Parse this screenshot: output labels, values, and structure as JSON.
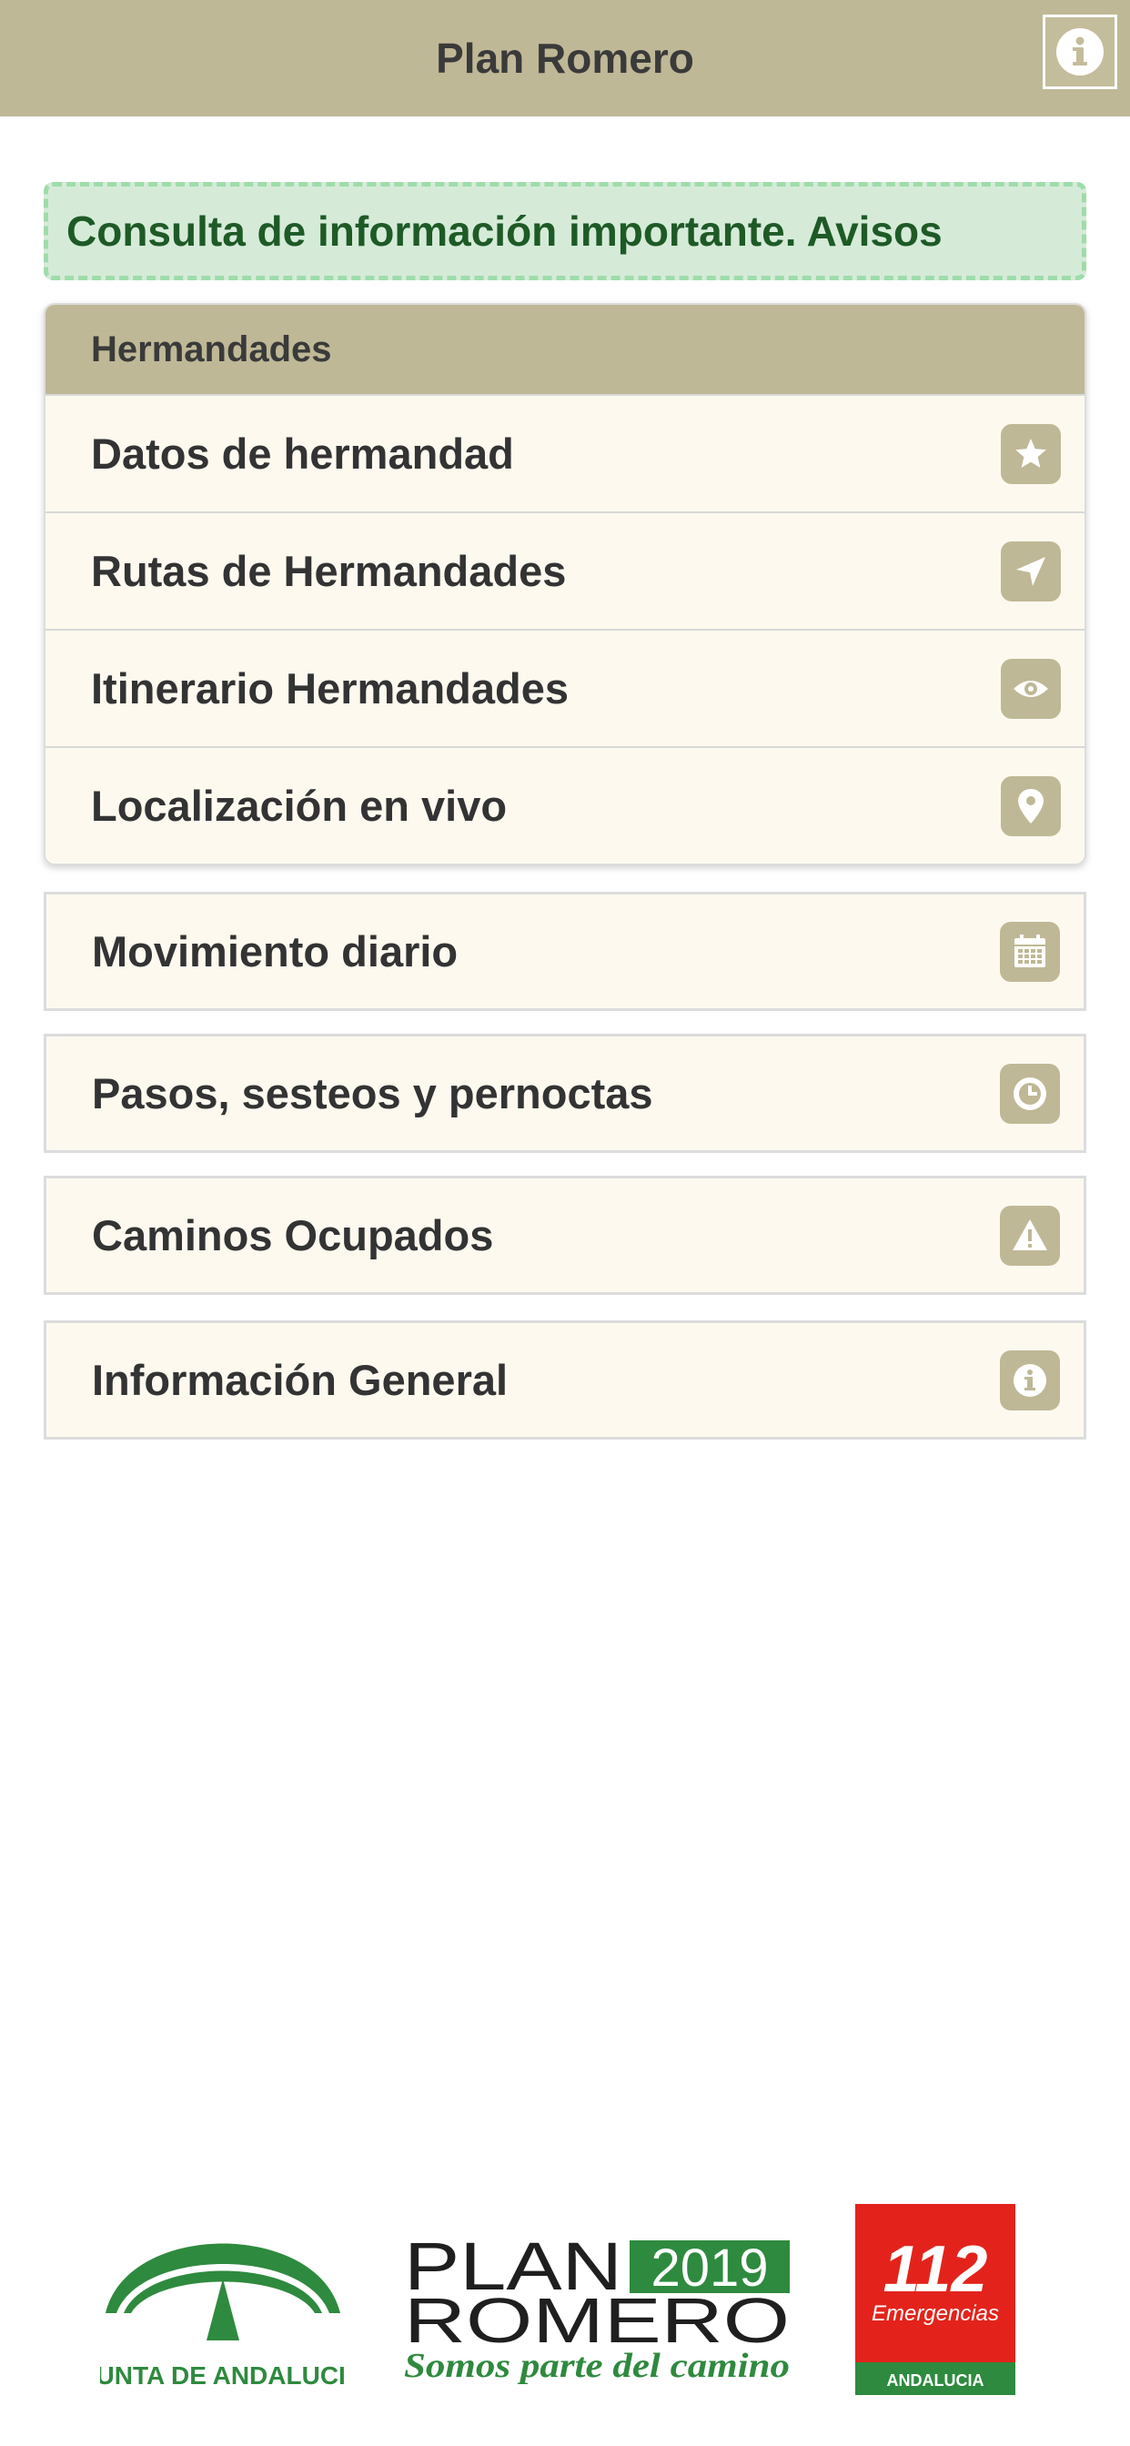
{
  "header": {
    "title": "Plan Romero",
    "info_icon": "info-icon"
  },
  "notice": {
    "text": "Consulta de información importante. Avisos"
  },
  "group": {
    "title": "Hermandades",
    "items": [
      {
        "label": "Datos de hermandad",
        "icon": "star-icon"
      },
      {
        "label": "Rutas de Hermandades",
        "icon": "navigation-arrow-icon"
      },
      {
        "label": "Itinerario Hermandades",
        "icon": "eye-icon"
      },
      {
        "label": "Localización en vivo",
        "icon": "location-pin-icon"
      }
    ]
  },
  "menu": [
    {
      "label": "Movimiento diario",
      "icon": "calendar-icon"
    },
    {
      "label": "Pasos, sesteos y pernoctas",
      "icon": "clock-icon"
    },
    {
      "label": "Caminos Ocupados",
      "icon": "warning-icon"
    },
    {
      "label": "Información General",
      "icon": "info-icon"
    }
  ],
  "footer": {
    "junta": "JUNTA DE ANDALUCIA",
    "plan_line1": "PLAN",
    "plan_year": "2019",
    "plan_line2": "ROMERO",
    "plan_tagline": "Somos parte del camino",
    "emergency_number": "112",
    "emergency_label": "Emergencias",
    "emergency_region": "ANDALUCIA"
  },
  "colors": {
    "header_bg": "#bfb896",
    "item_bg": "#fdf9ef",
    "notice_bg": "#d5ebd8",
    "notice_border": "#9fdcaa",
    "notice_text": "#1e5a26",
    "brand_green": "#2e8a3e",
    "emergency_red": "#e3231b"
  }
}
